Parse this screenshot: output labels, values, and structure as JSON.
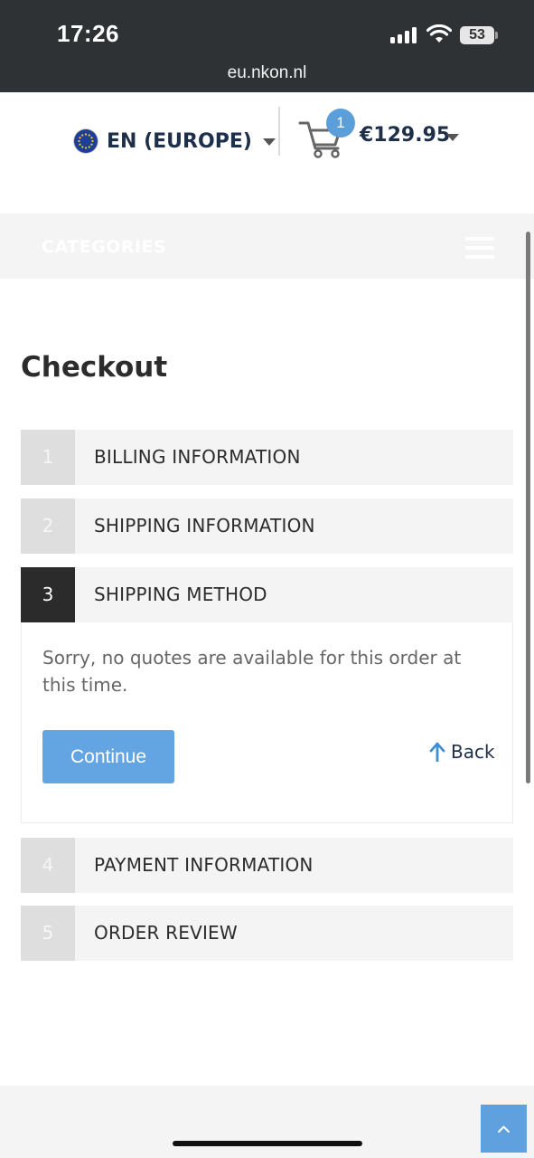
{
  "status_bar": {
    "time": "17:26",
    "battery": "53",
    "url": "eu.nkon.nl"
  },
  "header": {
    "language": "EN (EUROPE)",
    "cart_count": "1",
    "cart_total": "€129.95"
  },
  "nav": {
    "categories_label": "CATEGORIES"
  },
  "checkout": {
    "title": "Checkout",
    "steps": [
      {
        "number": "1",
        "label": "BILLING INFORMATION",
        "state": "inactive"
      },
      {
        "number": "2",
        "label": "SHIPPING INFORMATION",
        "state": "inactive"
      },
      {
        "number": "3",
        "label": "SHIPPING METHOD",
        "state": "active"
      },
      {
        "number": "4",
        "label": "PAYMENT INFORMATION",
        "state": "inactive"
      },
      {
        "number": "5",
        "label": "ORDER REVIEW",
        "state": "inactive"
      }
    ],
    "shipping_method": {
      "message": "Sorry, no quotes are available for this order at this time.",
      "continue_label": "Continue",
      "back_label": "Back"
    }
  },
  "colors": {
    "status_bar_bg": "#2f3235",
    "accent_blue": "#5ea1de",
    "active_step": "#2b2b2b",
    "inactive_step_num": "#dedede",
    "step_bg": "#f4f4f4",
    "brand_text": "#1e2f4a"
  },
  "icons": {
    "signal": "cellular-signal-icon",
    "wifi": "wifi-icon",
    "battery": "battery-icon",
    "flag": "eu-flag-icon",
    "cart": "shopping-cart-icon",
    "menu": "hamburger-menu-icon",
    "back": "arrow-up-icon",
    "to_top": "chevron-up-icon"
  }
}
